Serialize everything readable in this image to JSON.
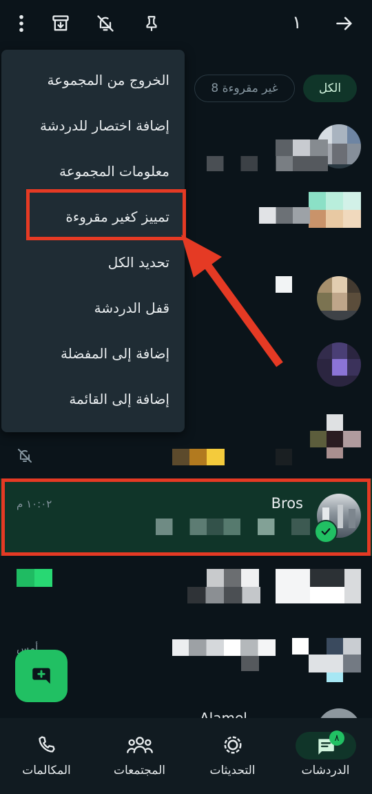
{
  "topbar": {
    "selected_count": "١",
    "icons": [
      "back-arrow-icon",
      "pin-icon",
      "mute-icon",
      "archive-icon",
      "more-vertical-icon"
    ]
  },
  "filters": {
    "all_label": "الكل",
    "unread_label": "غير مقروءة 8"
  },
  "menu": {
    "items": [
      "الخروج من المجموعة",
      "إضافة اختصار للدردشة",
      "معلومات المجموعة",
      "تمييز كغير مقروءة",
      "تحديد الكل",
      "قفل الدردشة",
      "إضافة إلى المفضلة",
      "إضافة إلى القائمة"
    ],
    "highlighted_index": 3
  },
  "chats": {
    "selected": {
      "name": "Bros",
      "time": "١٠:٠٢ م"
    },
    "partial_time": "أمس",
    "partial_text": "Alamel"
  },
  "bottom_nav": {
    "chats": "الدردشات",
    "chats_badge": "٨",
    "updates": "التحديثات",
    "communities": "المجتمعات",
    "calls": "المكالمات"
  },
  "colors": {
    "background": "#0b141a",
    "accent": "#21c063",
    "selected_row": "#103529",
    "annotation_red": "#e53a24"
  }
}
